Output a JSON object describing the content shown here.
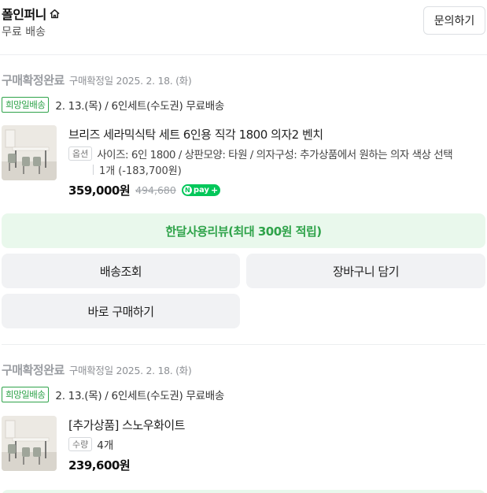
{
  "store": {
    "name": "폴인퍼니",
    "home_icon": "home-icon",
    "shipping": "무료 배송",
    "inquiry_label": "문의하기"
  },
  "orders": [
    {
      "status": "구매확정완료",
      "confirm_date": "구매확정일 2025. 2. 18. (화)",
      "delivery_badge": "희망일배송",
      "delivery_text": "2. 13.(목) / 6인세트(수도권) 무료배송",
      "product_title": "브리즈 세라믹식탁 세트 6인용 직각 1800 의자2 벤치",
      "option_tag": "옵션",
      "option_text": "사이즈: 6인 1800 / 상판모양: 타원 / 의자구성: 추가상품에서 원하는 의자 색상 선택",
      "option_qty": "1개",
      "option_discount": "(-183,700원)",
      "price": "359,000원",
      "original_price": "494,680",
      "npay_label": "pay",
      "review_label": "한달사용리뷰(최대 300원 적립)",
      "track_label": "배송조회",
      "cart_label": "장바구니 담기",
      "buy_label": "바로 구매하기"
    },
    {
      "status": "구매확정완료",
      "confirm_date": "구매확정일 2025. 2. 18. (화)",
      "delivery_badge": "희망일배송",
      "delivery_text": "2. 13.(목) / 6인세트(수도권) 무료배송",
      "product_title": "[추가상품] 스노우화이트",
      "qty_tag": "수량",
      "qty": "4개",
      "price": "239,600원"
    }
  ],
  "colors": {
    "accent_green": "#2fa34a",
    "review_bg": "#e9f8ec",
    "npay_green": "#03c75a",
    "button_bg": "#f1f2f4"
  }
}
